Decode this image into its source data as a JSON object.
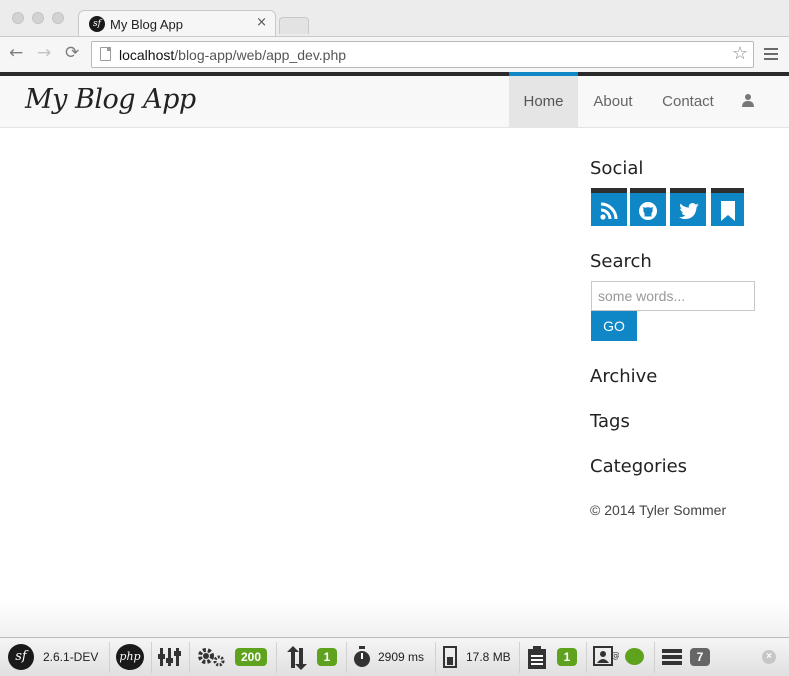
{
  "browser": {
    "tab_title": "My Blog App",
    "tab_close": "×",
    "tab_favicon": "sf",
    "back_glyph": "←",
    "forward_glyph": "→",
    "reload_glyph": "⟳",
    "url_host": "localhost",
    "url_path": "/blog-app/web/app_dev.php",
    "star_glyph": "☆"
  },
  "site": {
    "brand": "My Blog App",
    "nav": [
      {
        "label": "Home",
        "active": true
      },
      {
        "label": "About",
        "active": false
      },
      {
        "label": "Contact",
        "active": false
      }
    ],
    "accent_color": "#0f87c7"
  },
  "sidebar": {
    "social_heading": "Social",
    "social_icons": [
      "rss-icon",
      "github-icon",
      "twitter-icon",
      "bookmark-icon"
    ],
    "search_heading": "Search",
    "search_placeholder": "some words...",
    "search_button": "GO",
    "archive_heading": "Archive",
    "tags_heading": "Tags",
    "categories_heading": "Categories",
    "footer": "© 2014 Tyler Sommer"
  },
  "debug_toolbar": {
    "logo": "sf",
    "version": "2.6.1-DEV",
    "php_label": "php",
    "status_code": "200",
    "ajax_count": "1",
    "time": "2909 ms",
    "memory": "17.8 MB",
    "log_count": "1",
    "db_count": "7",
    "close_glyph": "×",
    "badge_green": "#5fa21e"
  }
}
